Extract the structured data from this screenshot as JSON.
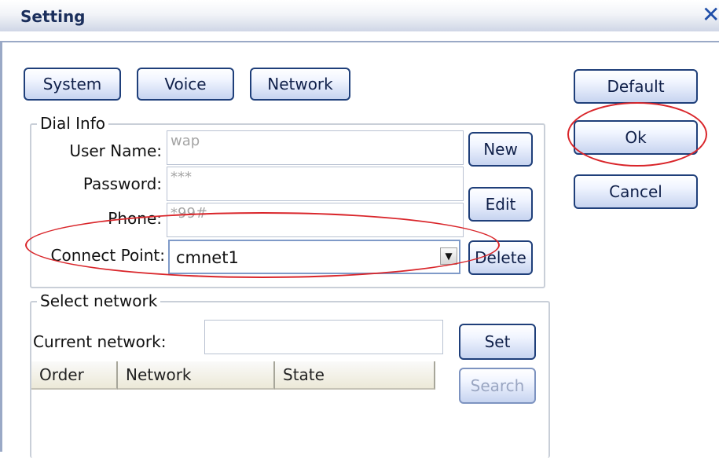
{
  "window": {
    "title": "Setting",
    "close_symbol": "✕"
  },
  "tabs": {
    "system": "System",
    "voice": "Voice",
    "network": "Network"
  },
  "side_buttons": {
    "default": "Default",
    "ok": "Ok",
    "cancel": "Cancel"
  },
  "dial_info": {
    "legend": "Dial Info",
    "user_name_label": "User Name:",
    "user_name_value": "wap",
    "password_label": "Password:",
    "password_value": "***",
    "phone_label": "Phone:",
    "phone_value": "*99#",
    "connect_point_label": "Connect Point:",
    "connect_point_value": "cmnet1",
    "new_button": "New",
    "edit_button": "Edit",
    "delete_button": "Delete"
  },
  "select_network": {
    "legend": "Select network",
    "current_network_label": "Current network:",
    "current_network_value": "",
    "set_button": "Set",
    "search_button": "Search",
    "columns": [
      "Order",
      "Network",
      "State"
    ],
    "rows": []
  },
  "annotations": {
    "highlight_color": "#d9252a"
  }
}
